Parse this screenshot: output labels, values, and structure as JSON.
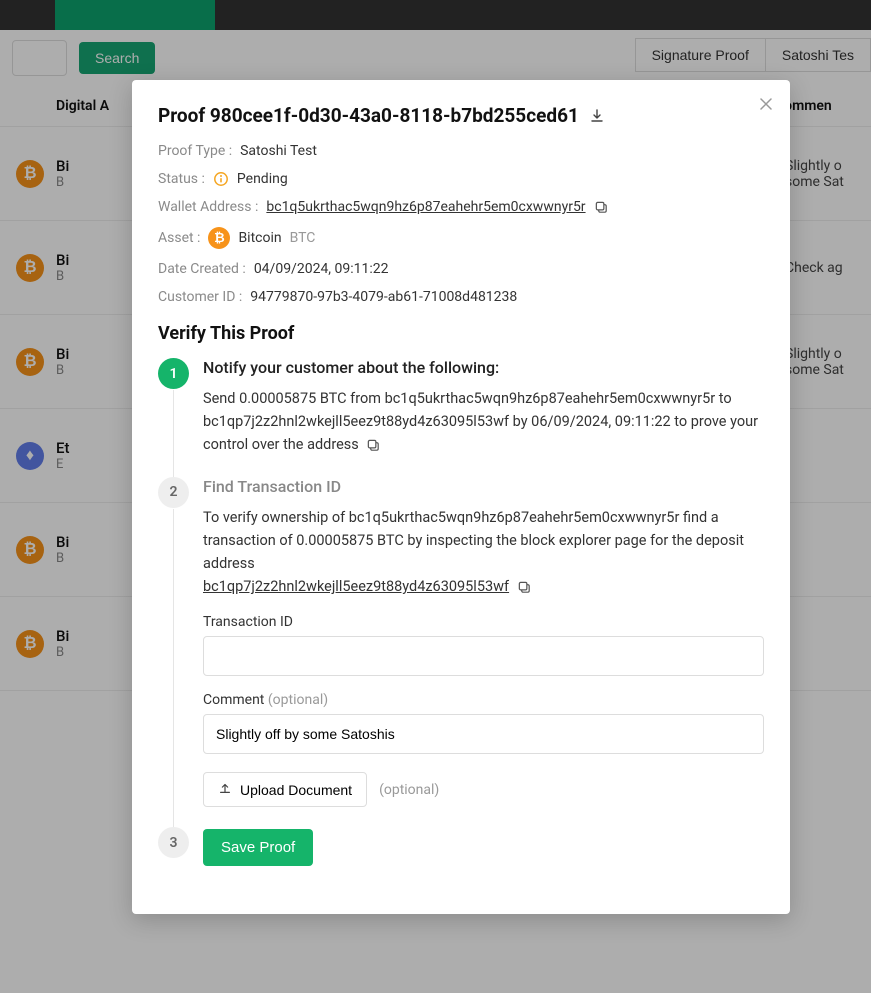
{
  "toolbar": {
    "search_label": "Search",
    "sig_proof_btn": "Signature Proof",
    "satoshi_btn": "Satoshi Tes"
  },
  "table": {
    "header_asset": "Digital A",
    "header_comment": "Commen",
    "rows": [
      {
        "icon": "btc",
        "name": "Bi",
        "sym": "B",
        "comment": "Slightly o some Sat"
      },
      {
        "icon": "btc",
        "name": "Bi",
        "sym": "B",
        "comment": "Check ag"
      },
      {
        "icon": "btc",
        "name": "Bi",
        "sym": "B",
        "comment": "Slightly o some Sat"
      },
      {
        "icon": "eth",
        "name": "Et",
        "sym": "E",
        "comment": ""
      },
      {
        "icon": "btc",
        "name": "Bi",
        "sym": "B",
        "comment": ""
      },
      {
        "icon": "btc",
        "name": "Bi",
        "sym": "B",
        "comment": ""
      }
    ]
  },
  "modal": {
    "title": "Proof 980cee1f-0d30-43a0-8118-b7bd255ced61",
    "proof_type_label": "Proof Type :",
    "proof_type_value": "Satoshi Test",
    "status_label": "Status :",
    "status_value": "Pending",
    "wallet_label": "Wallet Address :",
    "wallet_value": "bc1q5ukrthac5wqn9hz6p87eahehr5em0cxwwnyr5r",
    "asset_label": "Asset :",
    "asset_name": "Bitcoin",
    "asset_sym": "BTC",
    "date_label": "Date Created :",
    "date_value": "04/09/2024, 09:11:22",
    "customer_label": "Customer ID :",
    "customer_value": "94779870-97b3-4079-ab61-71008d481238",
    "section_title": "Verify This Proof",
    "step1_title": "Notify your customer about the following:",
    "step1_text": "Send 0.00005875 BTC from bc1q5ukrthac5wqn9hz6p87eahehr5em0cxwwnyr5r to bc1qp7j2z2hnl2wkejll5eez9t88yd4z63095l53wf by 06/09/2024, 09:11:22 to prove your control over the address",
    "step2_title": "Find Transaction ID",
    "step2_text_a": "To verify ownership of bc1q5ukrthac5wqn9hz6p87eahehr5em0cxwwnyr5r find a transaction of 0.00005875 BTC by inspecting the block explorer page for the deposit address",
    "step2_link": "bc1qp7j2z2hnl2wkejll5eez9t88yd4z63095l53wf",
    "txid_label": "Transaction ID",
    "comment_label": "Comment",
    "optional": "(optional)",
    "comment_value": "Slightly off by some Satoshis",
    "upload_label": "Upload Document",
    "step3_num": "3",
    "save_label": "Save Proof"
  }
}
